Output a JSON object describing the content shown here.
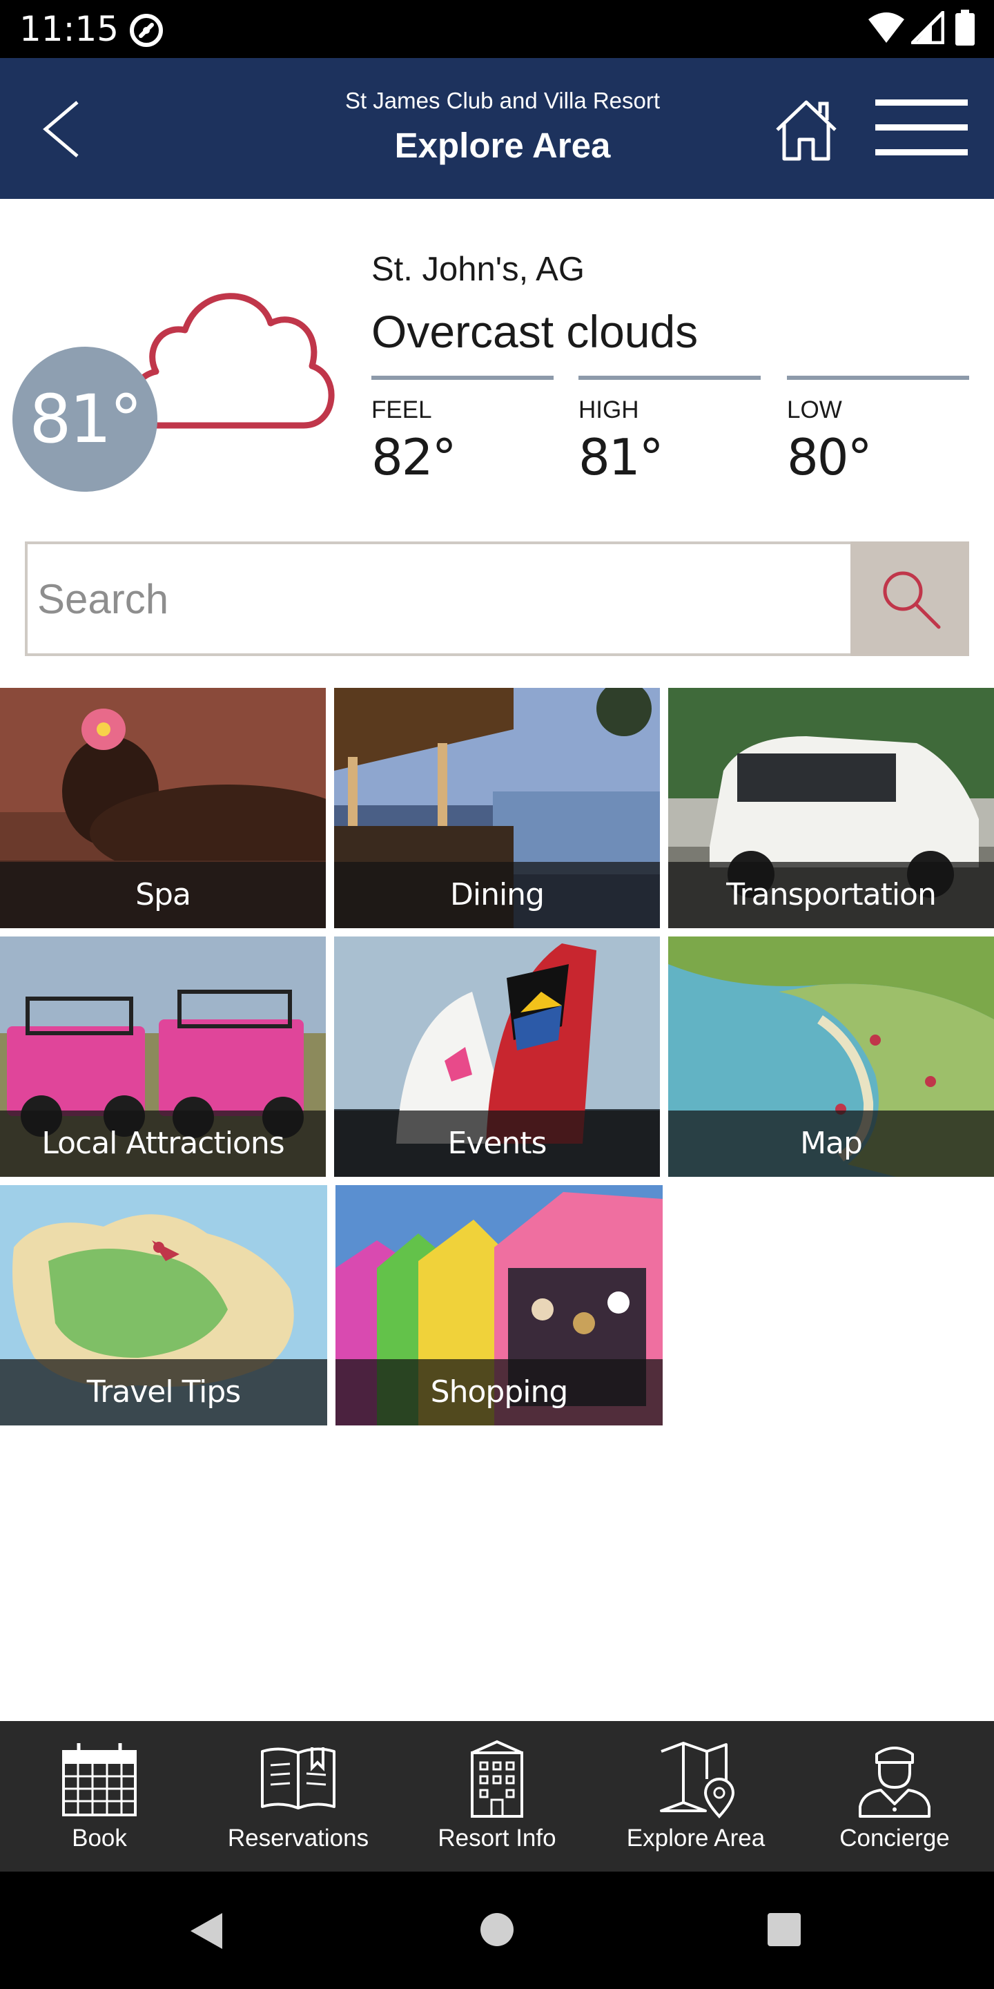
{
  "status_bar": {
    "time": "11:15"
  },
  "header": {
    "subtitle": "St James Club and Villa Resort",
    "title": "Explore Area",
    "colors": {
      "background": "#1d325d"
    }
  },
  "weather": {
    "temperature": "81°",
    "location": "St. John's, AG",
    "condition": "Overcast clouds",
    "icon": "cloud-icon",
    "stats": [
      {
        "label": "FEEL",
        "value": "82°"
      },
      {
        "label": "HIGH",
        "value": "81°"
      },
      {
        "label": "LOW",
        "value": "80°"
      }
    ]
  },
  "search": {
    "placeholder": "Search",
    "value": "",
    "icon": "search-icon"
  },
  "categories": [
    {
      "label": "Spa"
    },
    {
      "label": "Dining"
    },
    {
      "label": "Transportation"
    },
    {
      "label": "Local Attractions"
    },
    {
      "label": "Events"
    },
    {
      "label": "Map"
    },
    {
      "label": "Travel Tips"
    },
    {
      "label": "Shopping"
    }
  ],
  "bottom_nav": [
    {
      "label": "Book",
      "icon": "calendar-icon"
    },
    {
      "label": "Reservations",
      "icon": "book-icon"
    },
    {
      "label": "Resort Info",
      "icon": "building-icon"
    },
    {
      "label": "Explore Area",
      "icon": "map-pin-icon"
    },
    {
      "label": "Concierge",
      "icon": "concierge-icon"
    }
  ],
  "colors": {
    "accent": "#c0364a",
    "nav_background": "#2a2a2a"
  }
}
